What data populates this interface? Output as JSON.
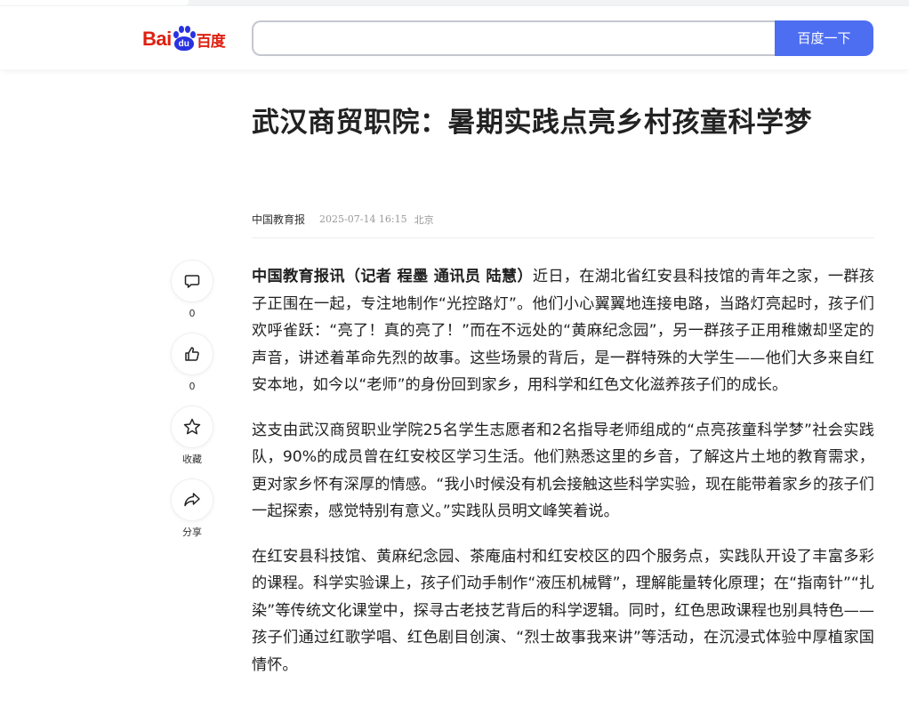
{
  "search": {
    "query": "",
    "button_label": "百度一下"
  },
  "logo": {
    "text_bai": "Bai",
    "text_du": "du",
    "text_cn": "百度"
  },
  "article": {
    "title": "武汉商贸职院：暑期实践点亮乡村孩童科学梦",
    "source": "中国教育报",
    "time": "2025-07-14 16:15",
    "location": "北京",
    "lead_bold": "中国教育报讯（记者 程墨 通讯员 陆慧）",
    "p1": "近日，在湖北省红安县科技馆的青年之家，一群孩子正围在一起，专注地制作“光控路灯”。他们小心翼翼地连接电路，当路灯亮起时，孩子们欢呼雀跃：“亮了！真的亮了！”而在不远处的“黄麻纪念园”，另一群孩子正用稚嫩却坚定的声音，讲述着革命先烈的故事。这些场景的背后，是一群特殊的大学生——他们大多来自红安本地，如今以“老师”的身份回到家乡，用科学和红色文化滋养孩子们的成长。",
    "p2": "这支由武汉商贸职业学院25名学生志愿者和2名指导老师组成的“点亮孩童科学梦”社会实践队，90%的成员曾在红安校区学习生活。他们熟悉这里的乡音，了解这片土地的教育需求，更对家乡怀有深厚的情感。“我小时候没有机会接触这些科学实验，现在能带着家乡的孩子们一起探索，感觉特别有意义。”实践队员明文峰笑着说。",
    "p3": "在红安县科技馆、黄麻纪念园、茶庵庙村和红安校区的四个服务点，实践队开设了丰富多彩的课程。科学实验课上，孩子们动手制作“液压机械臂”，理解能量转化原理；在“指南针”“扎染”等传统文化课堂中，探寻古老技艺背后的科学逻辑。同时，红色思政课程也别具特色——孩子们通过红歌学唱、红色剧目创演、“烈士故事我来讲”等活动，在沉浸式体验中厚植家国情怀。"
  },
  "actions": [
    {
      "icon": "comment-icon",
      "label": "0"
    },
    {
      "icon": "thumbs-up-icon",
      "label": "0"
    },
    {
      "icon": "star-icon",
      "label": "收藏"
    },
    {
      "icon": "share-icon",
      "label": "分享"
    }
  ],
  "colors": {
    "brand_red": "#de2010",
    "brand_blue": "#2932e1",
    "search_button": "#4e6ef2"
  }
}
